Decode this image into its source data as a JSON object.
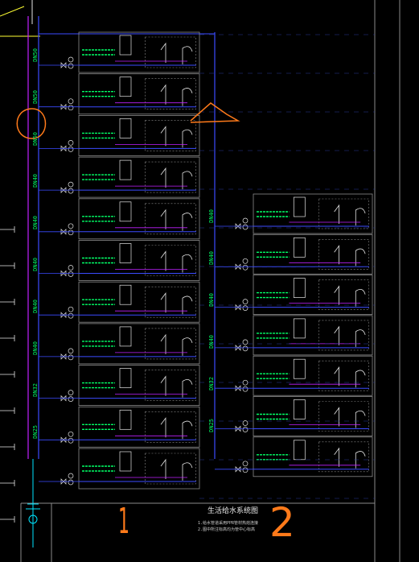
{
  "colors": {
    "background": "#000000",
    "blue_pipe": "#3b4bff",
    "magenta_pipe": "#c020ff",
    "green_text": "#00ff66",
    "gray_frame": "#8a8a8a",
    "white_line": "#e6e6e6",
    "annotation_orange": "#ff7a1a",
    "cyan": "#00e5ff",
    "yellow": "#ffff33"
  },
  "riser_labels_left": [
    "DN50",
    "DN50",
    "DN50",
    "DN40",
    "DN40",
    "DN40",
    "DN40",
    "DN40",
    "DN32",
    "DN25"
  ],
  "riser_labels_right": [
    "DN40",
    "DN40",
    "DN40",
    "DN40",
    "DN32",
    "DN25"
  ],
  "title_block": {
    "title": "生活给水系统图",
    "notes": [
      "1.给水管道采用PPR管材热熔连接",
      "2.图中所注标高均为管中心标高"
    ]
  },
  "annotations": {
    "number_1": "1",
    "number_2": "2"
  },
  "icons": {
    "valve": "valve-icon",
    "water-meter": "water-meter-icon",
    "fixture": "fixture-icon"
  }
}
